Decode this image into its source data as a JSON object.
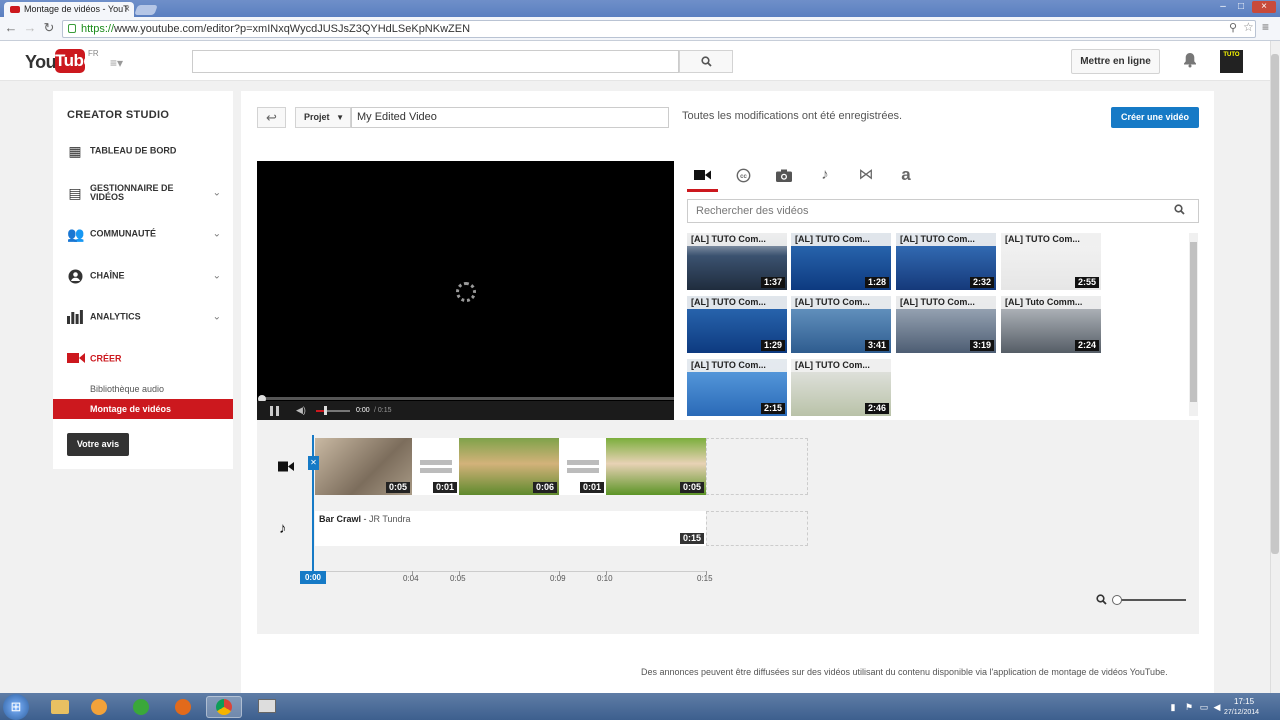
{
  "browser": {
    "tab_title": "Montage de vidéos - YouT",
    "url_scheme": "https://",
    "url_rest": "www.youtube.com/editor?p=xmINxqWycdJUSJsZ3QYHdLSeKpNKwZEN"
  },
  "header": {
    "logo_you": "You",
    "logo_tube": "Tube",
    "locale": "FR",
    "upload_label": "Mettre en ligne",
    "avatar_text": "TUTO"
  },
  "sidebar": {
    "title": "CREATOR STUDIO",
    "items": [
      {
        "label": "TABLEAU DE BORD",
        "icon": "dashboard-icon"
      },
      {
        "label": "GESTIONNAIRE DE VIDÉOS",
        "icon": "video-manager-icon"
      },
      {
        "label": "COMMUNAUTÉ",
        "icon": "community-icon"
      },
      {
        "label": "CHAÎNE",
        "icon": "channel-icon"
      },
      {
        "label": "ANALYTICS",
        "icon": "analytics-icon"
      },
      {
        "label": "CRÉER",
        "icon": "create-icon"
      }
    ],
    "subitems": [
      {
        "label": "Bibliothèque audio"
      },
      {
        "label": "Montage de vidéos"
      }
    ],
    "feedback_label": "Votre avis"
  },
  "editor": {
    "project_label": "Projet",
    "project_name": "My Edited Video",
    "save_status": "Toutes les modifications ont été enregistrées.",
    "create_label": "Créer une vidéo",
    "time_current": "0:00",
    "time_total": "/ 0:15",
    "search_placeholder": "Rechercher des vidéos",
    "videos": [
      {
        "title": "[AL] TUTO Com...",
        "duration": "1:37"
      },
      {
        "title": "[AL] TUTO Com...",
        "duration": "1:28"
      },
      {
        "title": "[AL] TUTO Com...",
        "duration": "2:32"
      },
      {
        "title": "[AL] TUTO Com...",
        "duration": "2:55"
      },
      {
        "title": "[AL] TUTO Com...",
        "duration": "1:29"
      },
      {
        "title": "[AL] TUTO Com...",
        "duration": "3:41"
      },
      {
        "title": "[AL] TUTO Com...",
        "duration": "3:19"
      },
      {
        "title": "[AL] Tuto Comm...",
        "duration": "2:24"
      },
      {
        "title": "[AL] TUTO Com...",
        "duration": "2:15"
      },
      {
        "title": "[AL] TUTO Com...",
        "duration": "2:46"
      }
    ],
    "timeline": {
      "clips": [
        {
          "duration": "0:05"
        },
        {
          "duration": "0:01"
        },
        {
          "duration": "0:06"
        },
        {
          "duration": "0:01"
        },
        {
          "duration": "0:05"
        }
      ],
      "audio_title": "Bar Crawl",
      "audio_sep": " - ",
      "audio_artist": "JR Tundra",
      "audio_duration": "0:15",
      "playhead": "0:00",
      "ticks": [
        "0:04",
        "0:05",
        "0:09",
        "0:10",
        "0:15"
      ]
    },
    "disclaimer": "Des annonces peuvent être diffusées sur des vidéos utilisant du contenu disponible via l'application de montage de vidéos YouTube."
  },
  "taskbar": {
    "time": "17:15",
    "date": "27/12/2014"
  }
}
